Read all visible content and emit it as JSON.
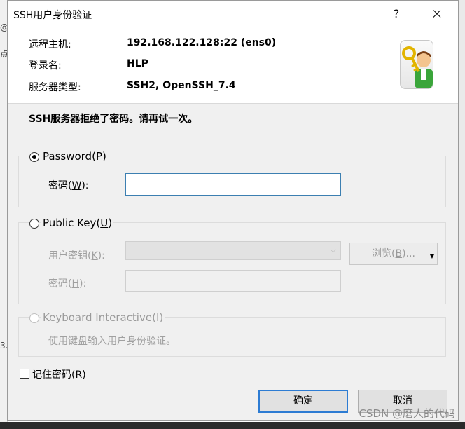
{
  "dialog": {
    "title": "SSH用户身份验证",
    "help_label": "?",
    "info": {
      "remote_host_label": "远程主机:",
      "remote_host_value": "192.168.122.128:22 (ens0)",
      "login_name_label": "登录名:",
      "login_name_value": "HLP",
      "server_type_label": "服务器类型:",
      "server_type_value": "SSH2, OpenSSH_7.4"
    },
    "message": "SSH服务器拒绝了密码。请再试一次。",
    "password_group": {
      "title": "Password",
      "mnemonic": "P",
      "field_label": "密码",
      "field_mnemonic": "W",
      "field_value": ""
    },
    "public_key_group": {
      "title": "Public Key",
      "mnemonic": "U",
      "user_key_label": "用户密钥",
      "user_key_mnemonic": "K",
      "user_key_value": "",
      "browse_label": "浏览",
      "browse_mnemonic": "B",
      "passphrase_label": "密码",
      "passphrase_mnemonic": "H",
      "passphrase_value": ""
    },
    "keyboard_group": {
      "title": "Keyboard Interactive",
      "mnemonic": "I",
      "description": "使用键盘输入用户身份验证。"
    },
    "remember": {
      "label": "记住密码",
      "mnemonic": "R",
      "checked": false
    },
    "ok_label": "确定",
    "cancel_label": "取消"
  },
  "background": {
    "fragments": [
      "@",
      "点",
      "3."
    ]
  },
  "watermark": "CSDN @磨人的代码",
  "colors": {
    "accent": "#2d7cd3",
    "focus_border": "#3c7fb1",
    "dialog_bg": "#f0f0f0"
  }
}
